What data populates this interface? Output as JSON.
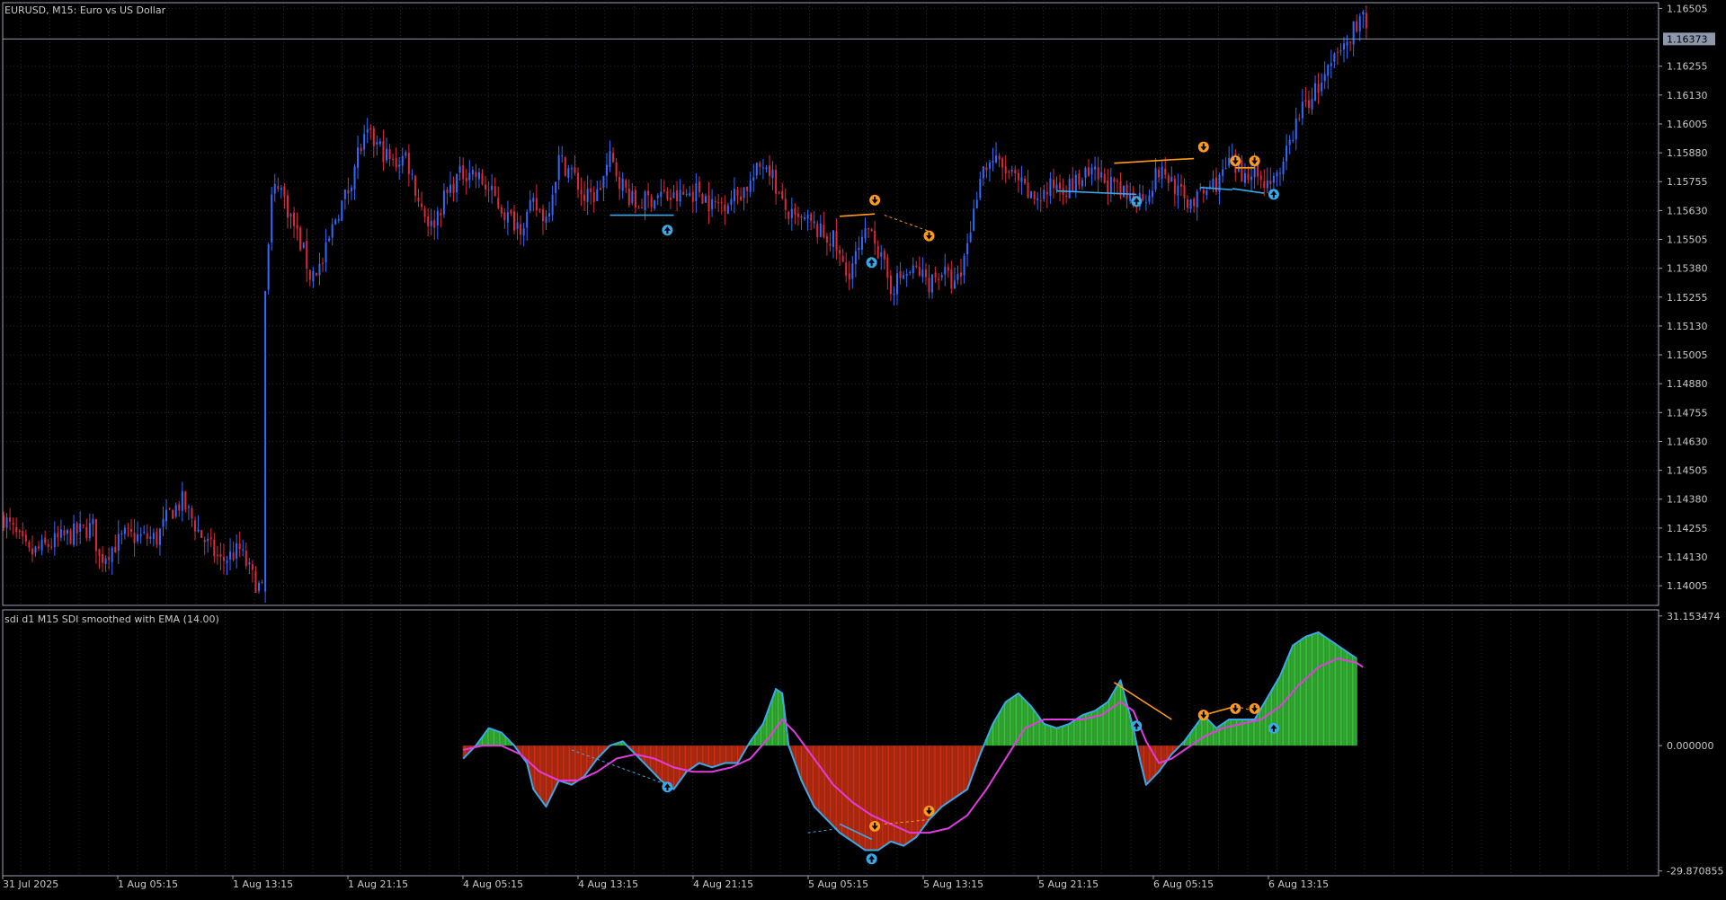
{
  "symbol_header": "EURUSD, M15:  Euro vs US Dollar",
  "indicator_header": "sdi d1 M15 SDI smoothed with EMA (14.00)",
  "colors": {
    "background": "#000000",
    "grid": "#1c2a44",
    "frame": "#9aa0b4",
    "text": "#c8c8c8",
    "bull": "#2f6bff",
    "bear": "#e0283c",
    "hist_pos": "#3cc83c",
    "hist_neg": "#d23214",
    "sdi_line": "#3aa9e8",
    "ema_line": "#e13ce1",
    "up_arrow": "#3aa9e8",
    "down_arrow": "#ff9a1e",
    "price_line": "#8e98ad",
    "price_badge_bg": "#8e98ad",
    "price_badge_text": "#000000"
  },
  "price_axis": {
    "ticks": [
      "1.16505",
      "1.16255",
      "1.16130",
      "1.16005",
      "1.15880",
      "1.15755",
      "1.15630",
      "1.15505",
      "1.15380",
      "1.15255",
      "1.15130",
      "1.15005",
      "1.14880",
      "1.14755",
      "1.14630",
      "1.14505",
      "1.14380",
      "1.14255",
      "1.14130",
      "1.14005"
    ],
    "current": "1.16373"
  },
  "indicator_axis": {
    "ticks": [
      "31.153474",
      "0.000000",
      "-29.870855"
    ]
  },
  "time_axis": {
    "labels": [
      "31 Jul 2025",
      "1 Aug 05:15",
      "1 Aug 13:15",
      "1 Aug 21:15",
      "4 Aug 05:15",
      "4 Aug 13:15",
      "4 Aug 21:15",
      "5 Aug 05:15",
      "5 Aug 13:15",
      "5 Aug 21:15",
      "6 Aug 05:15",
      "6 Aug 13:15"
    ]
  },
  "chart_data": [
    {
      "type": "candlestick",
      "title": "EURUSD, M15:  Euro vs US Dollar",
      "ylim": [
        1.1392,
        1.1653
      ],
      "current_price": 1.16373,
      "price_path": [
        [
          0,
          1.143
        ],
        [
          8,
          1.1414
        ],
        [
          18,
          1.1421
        ],
        [
          28,
          1.1426
        ],
        [
          30,
          1.1412
        ],
        [
          38,
          1.1422
        ],
        [
          48,
          1.1421
        ],
        [
          52,
          1.1432
        ],
        [
          56,
          1.1437
        ],
        [
          62,
          1.1422
        ],
        [
          68,
          1.1411
        ],
        [
          74,
          1.1416
        ],
        [
          78,
          1.1404
        ],
        [
          81,
          1.1398
        ],
        [
          82,
          1.1527
        ],
        [
          84,
          1.1568
        ],
        [
          86,
          1.1576
        ],
        [
          90,
          1.156
        ],
        [
          94,
          1.1545
        ],
        [
          96,
          1.1535
        ],
        [
          100,
          1.154
        ],
        [
          104,
          1.156
        ],
        [
          108,
          1.1572
        ],
        [
          111,
          1.1588
        ],
        [
          114,
          1.1595
        ],
        [
          118,
          1.159
        ],
        [
          122,
          1.1583
        ],
        [
          126,
          1.1587
        ],
        [
          130,
          1.1568
        ],
        [
          134,
          1.1556
        ],
        [
          138,
          1.1568
        ],
        [
          142,
          1.1577
        ],
        [
          146,
          1.1581
        ],
        [
          150,
          1.1575
        ],
        [
          154,
          1.1568
        ],
        [
          158,
          1.156
        ],
        [
          162,
          1.1557
        ],
        [
          166,
          1.1565
        ],
        [
          170,
          1.156
        ],
        [
          174,
          1.1585
        ],
        [
          178,
          1.158
        ],
        [
          182,
          1.1568
        ],
        [
          186,
          1.157
        ],
        [
          190,
          1.1585
        ],
        [
          194,
          1.1574
        ],
        [
          198,
          1.1565
        ],
        [
          202,
          1.1568
        ],
        [
          206,
          1.157
        ],
        [
          210,
          1.1568
        ],
        [
          214,
          1.157
        ],
        [
          218,
          1.1572
        ],
        [
          222,
          1.1565
        ],
        [
          226,
          1.1567
        ],
        [
          230,
          1.157
        ],
        [
          234,
          1.1575
        ],
        [
          238,
          1.1584
        ],
        [
          240,
          1.1582
        ],
        [
          244,
          1.1565
        ],
        [
          248,
          1.1558
        ],
        [
          252,
          1.1558
        ],
        [
          256,
          1.1553
        ],
        [
          260,
          1.155
        ],
        [
          264,
          1.1535
        ],
        [
          268,
          1.1545
        ],
        [
          272,
          1.1558
        ],
        [
          274,
          1.1545
        ],
        [
          278,
          1.153
        ],
        [
          282,
          1.1535
        ],
        [
          286,
          1.1537
        ],
        [
          290,
          1.1532
        ],
        [
          294,
          1.1537
        ],
        [
          298,
          1.153
        ],
        [
          300,
          1.1535
        ],
        [
          302,
          1.155
        ],
        [
          304,
          1.1562
        ],
        [
          306,
          1.158
        ],
        [
          310,
          1.1585
        ],
        [
          314,
          1.158
        ],
        [
          318,
          1.1575
        ],
        [
          322,
          1.1568
        ],
        [
          326,
          1.157
        ],
        [
          330,
          1.1575
        ],
        [
          334,
          1.1573
        ],
        [
          338,
          1.1577
        ],
        [
          342,
          1.1578
        ],
        [
          346,
          1.1575
        ],
        [
          350,
          1.157
        ],
        [
          354,
          1.1568
        ],
        [
          358,
          1.157
        ],
        [
          362,
          1.158
        ],
        [
          366,
          1.1576
        ],
        [
          370,
          1.1567
        ],
        [
          374,
          1.1568
        ],
        [
          378,
          1.1573
        ],
        [
          382,
          1.1578
        ],
        [
          384,
          1.1584
        ],
        [
          388,
          1.1578
        ],
        [
          392,
          1.1583
        ],
        [
          394,
          1.1575
        ],
        [
          398,
          1.1578
        ],
        [
          400,
          1.1575
        ],
        [
          402,
          1.1588
        ],
        [
          406,
          1.1605
        ],
        [
          410,
          1.1613
        ],
        [
          414,
          1.162
        ],
        [
          418,
          1.163
        ],
        [
          422,
          1.1638
        ],
        [
          424,
          1.1645
        ],
        [
          426,
          1.1648
        ],
        [
          427,
          1.164
        ]
      ],
      "annotations": {
        "up_arrows": [
          [
            208,
            1.15545
          ],
          [
            272,
            1.15405
          ],
          [
            355,
            1.1567
          ],
          [
            398,
            1.157
          ]
        ],
        "down_arrows": [
          [
            273,
            1.15675
          ],
          [
            290,
            1.1552
          ],
          [
            376,
            1.15905
          ],
          [
            386,
            1.15845
          ],
          [
            392,
            1.15845
          ]
        ],
        "blue_lines": [
          [
            [
              190,
              1.1561
            ],
            [
              210,
              1.1561
            ]
          ],
          [
            [
              330,
              1.15715
            ],
            [
              355,
              1.157
            ]
          ],
          [
            [
              375,
              1.1573
            ],
            [
              385,
              1.1572
            ]
          ],
          [
            [
              385,
              1.15725
            ],
            [
              395,
              1.15705
            ]
          ]
        ],
        "orange_lines": [
          [
            [
              262,
              1.15605
            ],
            [
              273,
              1.15615
            ]
          ],
          [
            [
              348,
              1.15835
            ],
            [
              366,
              1.1585
            ]
          ],
          [
            [
              366,
              1.1585
            ],
            [
              373,
              1.15855
            ]
          ],
          [
            [
              386,
              1.15815
            ],
            [
              392,
              1.15815
            ]
          ]
        ],
        "dashed_blue": [
          [
            [
              190,
              1.1561
            ],
            [
              208,
              1.1561
            ]
          ]
        ],
        "dashed_orange": [
          [
            [
              276,
              1.1561
            ],
            [
              290,
              1.1554
            ]
          ]
        ]
      }
    },
    {
      "type": "histogram",
      "title": "sdi d1 M15 SDI smoothed with EMA (14.00)",
      "ylim": [
        -29.870855,
        31.153474
      ],
      "sdi_path": [
        [
          144,
          -3
        ],
        [
          148,
          0
        ],
        [
          152,
          4
        ],
        [
          156,
          3
        ],
        [
          160,
          0
        ],
        [
          164,
          -4
        ],
        [
          166,
          -10
        ],
        [
          170,
          -14
        ],
        [
          174,
          -8
        ],
        [
          178,
          -9
        ],
        [
          182,
          -7
        ],
        [
          186,
          -3
        ],
        [
          190,
          0
        ],
        [
          194,
          1
        ],
        [
          198,
          -2
        ],
        [
          202,
          -5
        ],
        [
          206,
          -8
        ],
        [
          210,
          -10
        ],
        [
          214,
          -6
        ],
        [
          218,
          -4
        ],
        [
          222,
          -5
        ],
        [
          226,
          -4
        ],
        [
          230,
          -4
        ],
        [
          234,
          1
        ],
        [
          238,
          5
        ],
        [
          242,
          13
        ],
        [
          244,
          12
        ],
        [
          246,
          0
        ],
        [
          250,
          -8
        ],
        [
          254,
          -14
        ],
        [
          258,
          -17
        ],
        [
          262,
          -20
        ],
        [
          266,
          -22
        ],
        [
          270,
          -24
        ],
        [
          274,
          -24
        ],
        [
          278,
          -22
        ],
        [
          282,
          -23
        ],
        [
          286,
          -21
        ],
        [
          290,
          -17
        ],
        [
          294,
          -14
        ],
        [
          298,
          -12
        ],
        [
          302,
          -10
        ],
        [
          306,
          -2
        ],
        [
          310,
          5
        ],
        [
          314,
          10
        ],
        [
          318,
          12
        ],
        [
          322,
          9
        ],
        [
          326,
          5
        ],
        [
          330,
          4
        ],
        [
          334,
          5
        ],
        [
          338,
          7
        ],
        [
          342,
          8
        ],
        [
          346,
          10
        ],
        [
          350,
          15
        ],
        [
          354,
          4
        ],
        [
          356,
          -3
        ],
        [
          358,
          -9
        ],
        [
          362,
          -6
        ],
        [
          366,
          -2
        ],
        [
          370,
          1
        ],
        [
          374,
          5
        ],
        [
          376,
          7
        ],
        [
          380,
          4
        ],
        [
          384,
          6
        ],
        [
          388,
          6
        ],
        [
          392,
          6
        ],
        [
          396,
          11
        ],
        [
          400,
          16
        ],
        [
          404,
          23
        ],
        [
          408,
          25
        ],
        [
          412,
          26
        ],
        [
          416,
          24
        ],
        [
          420,
          22
        ],
        [
          424,
          20
        ]
      ],
      "ema_path": [
        [
          144,
          -1
        ],
        [
          150,
          0
        ],
        [
          156,
          0
        ],
        [
          162,
          -2
        ],
        [
          168,
          -6
        ],
        [
          174,
          -8
        ],
        [
          180,
          -8
        ],
        [
          186,
          -6
        ],
        [
          192,
          -3
        ],
        [
          198,
          -2
        ],
        [
          204,
          -3
        ],
        [
          210,
          -5
        ],
        [
          216,
          -6
        ],
        [
          222,
          -6
        ],
        [
          228,
          -5
        ],
        [
          234,
          -3
        ],
        [
          240,
          2
        ],
        [
          244,
          6
        ],
        [
          248,
          3
        ],
        [
          254,
          -3
        ],
        [
          260,
          -9
        ],
        [
          266,
          -13
        ],
        [
          272,
          -16
        ],
        [
          278,
          -18
        ],
        [
          284,
          -20
        ],
        [
          290,
          -20
        ],
        [
          296,
          -19
        ],
        [
          302,
          -16
        ],
        [
          308,
          -10
        ],
        [
          314,
          -3
        ],
        [
          320,
          4
        ],
        [
          326,
          6
        ],
        [
          332,
          6
        ],
        [
          338,
          6
        ],
        [
          344,
          7
        ],
        [
          350,
          10
        ],
        [
          354,
          8
        ],
        [
          358,
          1
        ],
        [
          362,
          -4
        ],
        [
          366,
          -3
        ],
        [
          370,
          -1
        ],
        [
          376,
          2
        ],
        [
          382,
          4
        ],
        [
          388,
          5
        ],
        [
          394,
          6
        ],
        [
          400,
          9
        ],
        [
          406,
          14
        ],
        [
          412,
          18
        ],
        [
          418,
          20
        ],
        [
          424,
          19
        ],
        [
          426,
          18
        ]
      ],
      "annotations": {
        "up_arrows": [
          [
            208,
            -9.5
          ],
          [
            272,
            -26.0
          ],
          [
            355,
            4.5
          ],
          [
            398,
            4.0
          ]
        ],
        "down_arrows": [
          [
            273,
            -18.5
          ],
          [
            290,
            -15.0
          ],
          [
            376,
            7.0
          ],
          [
            386,
            8.5
          ],
          [
            392,
            8.5
          ]
        ],
        "blue_lines": [
          [
            [
              262,
              -18.0
            ],
            [
              272,
              -21.5
            ]
          ]
        ],
        "orange_lines": [
          [
            [
              348,
              14.5
            ],
            [
              366,
              6.0
            ]
          ],
          [
            [
              376,
              7.0
            ],
            [
              386,
              9.0
            ]
          ]
        ],
        "dashed_blue": [
          [
            [
              178,
              -1.0
            ],
            [
              208,
              -9.0
            ]
          ],
          [
            [
              252,
              -20.0
            ],
            [
              262,
              -19.0
            ]
          ]
        ],
        "dashed_orange": [
          [
            [
              276,
              -18.0
            ],
            [
              290,
              -17.0
            ]
          ],
          [
            [
              386,
              9.0
            ],
            [
              392,
              8.0
            ]
          ]
        ]
      }
    }
  ]
}
